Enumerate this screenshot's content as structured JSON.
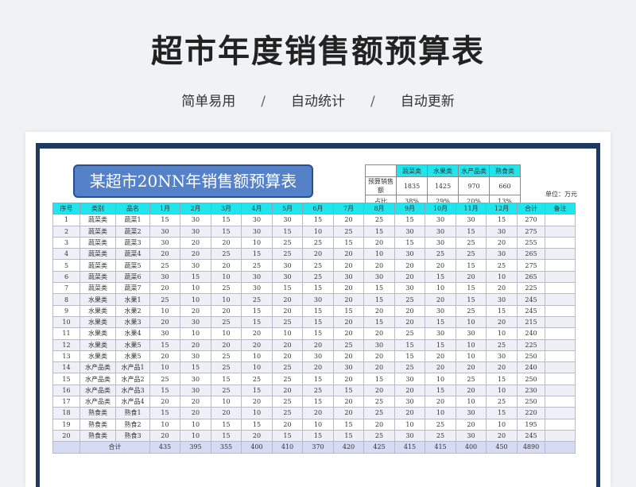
{
  "hero": {
    "title": "超市年度销售额预算表",
    "features": [
      "简单易用",
      "自动统计",
      "自动更新"
    ],
    "separator": "/"
  },
  "sheet": {
    "banner_title": "某超市20NN年销售额预算表",
    "unit_label": "单位：万元",
    "summary": {
      "categories": [
        "蔬菜类",
        "水果类",
        "水产品类",
        "熟食类"
      ],
      "rows": [
        {
          "label": "预算销售额",
          "values": [
            "1835",
            "1425",
            "970",
            "660"
          ]
        },
        {
          "label": "占比",
          "values": [
            "38%",
            "29%",
            "20%",
            "13%"
          ]
        }
      ]
    },
    "table": {
      "columns": [
        "序号",
        "类别",
        "品名",
        "1月",
        "2月",
        "3月",
        "4月",
        "5月",
        "6月",
        "7月",
        "8月",
        "9月",
        "10月",
        "11月",
        "12月",
        "合计",
        "备注"
      ],
      "rows": [
        [
          "1",
          "蔬菜类",
          "蔬菜1",
          "15",
          "30",
          "15",
          "30",
          "30",
          "15",
          "20",
          "25",
          "15",
          "30",
          "30",
          "15",
          "270",
          ""
        ],
        [
          "2",
          "蔬菜类",
          "蔬菜2",
          "30",
          "30",
          "15",
          "30",
          "15",
          "10",
          "25",
          "15",
          "30",
          "30",
          "15",
          "30",
          "275",
          ""
        ],
        [
          "3",
          "蔬菜类",
          "蔬菜3",
          "30",
          "20",
          "20",
          "10",
          "25",
          "25",
          "15",
          "20",
          "15",
          "30",
          "25",
          "20",
          "255",
          ""
        ],
        [
          "4",
          "蔬菜类",
          "蔬菜4",
          "20",
          "20",
          "25",
          "15",
          "25",
          "20",
          "20",
          "10",
          "30",
          "25",
          "25",
          "30",
          "265",
          ""
        ],
        [
          "5",
          "蔬菜类",
          "蔬菜5",
          "25",
          "30",
          "20",
          "25",
          "30",
          "25",
          "20",
          "20",
          "20",
          "20",
          "15",
          "25",
          "275",
          ""
        ],
        [
          "6",
          "蔬菜类",
          "蔬菜6",
          "30",
          "15",
          "10",
          "30",
          "30",
          "25",
          "30",
          "30",
          "20",
          "15",
          "20",
          "10",
          "265",
          ""
        ],
        [
          "7",
          "蔬菜类",
          "蔬菜7",
          "20",
          "10",
          "25",
          "30",
          "15",
          "15",
          "20",
          "15",
          "30",
          "10",
          "15",
          "20",
          "225",
          ""
        ],
        [
          "8",
          "水果类",
          "水果1",
          "25",
          "10",
          "10",
          "25",
          "20",
          "30",
          "20",
          "15",
          "25",
          "20",
          "15",
          "30",
          "245",
          ""
        ],
        [
          "9",
          "水果类",
          "水果2",
          "10",
          "20",
          "20",
          "15",
          "20",
          "15",
          "15",
          "20",
          "20",
          "30",
          "25",
          "15",
          "245",
          ""
        ],
        [
          "10",
          "水果类",
          "水果3",
          "20",
          "30",
          "25",
          "15",
          "25",
          "15",
          "20",
          "15",
          "20",
          "15",
          "10",
          "20",
          "215",
          ""
        ],
        [
          "11",
          "水果类",
          "水果4",
          "30",
          "10",
          "10",
          "20",
          "10",
          "15",
          "20",
          "20",
          "25",
          "30",
          "30",
          "10",
          "240",
          ""
        ],
        [
          "12",
          "水果类",
          "水果5",
          "15",
          "20",
          "20",
          "20",
          "20",
          "20",
          "25",
          "30",
          "15",
          "15",
          "10",
          "25",
          "225",
          ""
        ],
        [
          "13",
          "水果类",
          "水果5",
          "20",
          "30",
          "25",
          "10",
          "20",
          "30",
          "20",
          "20",
          "15",
          "20",
          "10",
          "30",
          "250",
          ""
        ],
        [
          "14",
          "水产品类",
          "水产品1",
          "10",
          "15",
          "25",
          "10",
          "25",
          "20",
          "30",
          "20",
          "25",
          "20",
          "20",
          "20",
          "240",
          ""
        ],
        [
          "15",
          "水产品类",
          "水产品2",
          "25",
          "30",
          "15",
          "25",
          "25",
          "15",
          "20",
          "15",
          "30",
          "10",
          "25",
          "15",
          "250",
          ""
        ],
        [
          "16",
          "水产品类",
          "水产品3",
          "15",
          "30",
          "25",
          "15",
          "20",
          "25",
          "15",
          "20",
          "20",
          "15",
          "20",
          "10",
          "230",
          ""
        ],
        [
          "17",
          "水产品类",
          "水产品4",
          "20",
          "20",
          "10",
          "20",
          "25",
          "15",
          "20",
          "25",
          "30",
          "20",
          "10",
          "25",
          "250",
          ""
        ],
        [
          "18",
          "熟食类",
          "熟食1",
          "15",
          "20",
          "20",
          "10",
          "25",
          "20",
          "20",
          "25",
          "20",
          "10",
          "30",
          "15",
          "220",
          ""
        ],
        [
          "19",
          "熟食类",
          "熟食2",
          "10",
          "10",
          "15",
          "15",
          "20",
          "10",
          "15",
          "20",
          "10",
          "25",
          "20",
          "10",
          "195",
          ""
        ],
        [
          "20",
          "熟食类",
          "熟食3",
          "20",
          "10",
          "15",
          "20",
          "15",
          "15",
          "15",
          "25",
          "30",
          "25",
          "30",
          "20",
          "245",
          ""
        ]
      ],
      "footer": {
        "label": "合计",
        "values": [
          "435",
          "395",
          "355",
          "400",
          "410",
          "370",
          "420",
          "425",
          "415",
          "415",
          "400",
          "450",
          "4890"
        ]
      }
    }
  }
}
